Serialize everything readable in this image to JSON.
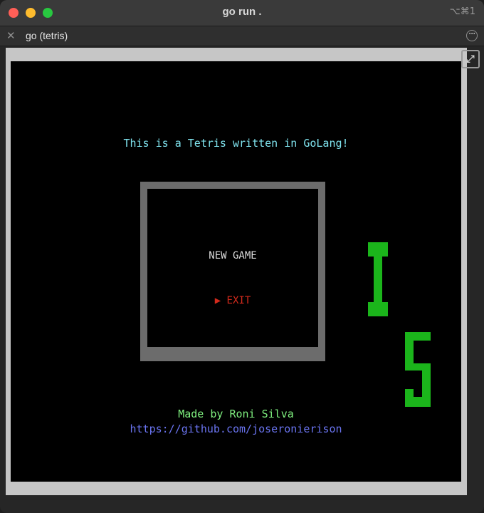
{
  "window": {
    "title": "go run .",
    "shortcut": "⌥⌘1"
  },
  "tab": {
    "label": "go (tetris)",
    "close_icon": "close-icon",
    "more_icon": "more-options-icon"
  },
  "game": {
    "headline": "This is a Tetris written in GoLang!",
    "menu": {
      "new_game": "NEW GAME",
      "exit": "▶ EXIT",
      "selected": "EXIT"
    },
    "credits": "Made by Roni Silva",
    "link": "https://github.com/joseronierison",
    "logo_letters": "IS"
  },
  "colors": {
    "headline": "#7fe3ee",
    "credits": "#7ff07f",
    "link": "#6a74f0",
    "selected_menu": "#d42a1c",
    "logo_green": "#1bb51b",
    "menu_frame": "#6c6c6c"
  }
}
